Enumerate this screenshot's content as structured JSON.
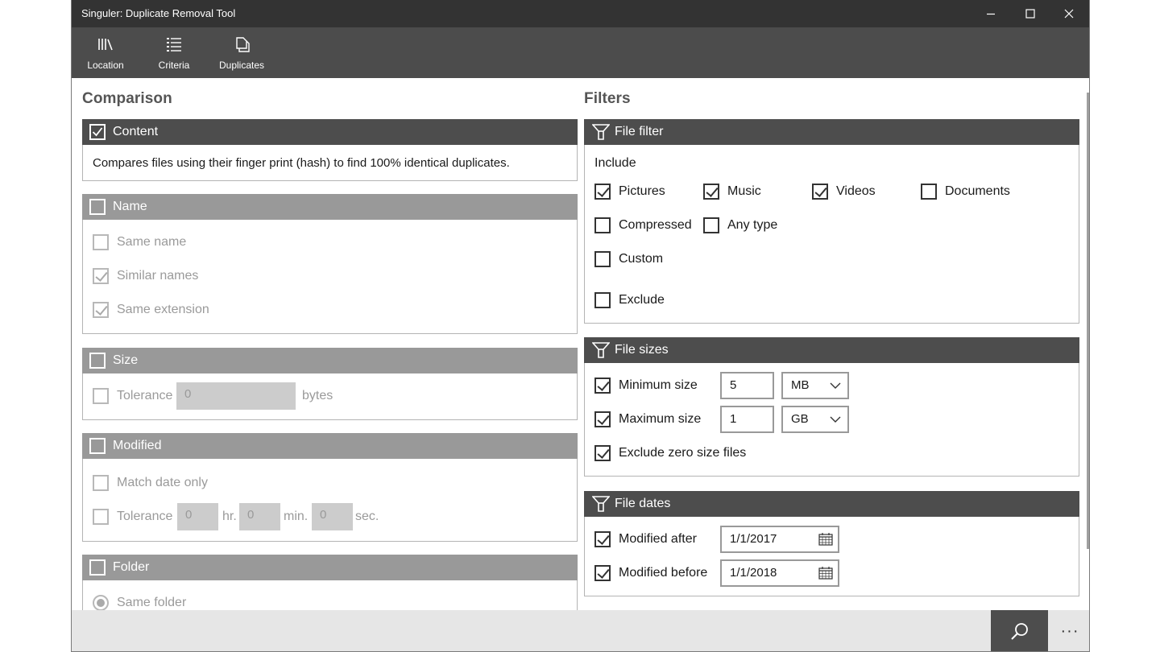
{
  "window": {
    "title": "Singuler: Duplicate Removal Tool",
    "controls": [
      "minimize-icon",
      "maximize-icon",
      "close-icon"
    ]
  },
  "nav": {
    "items": [
      {
        "label": "Location",
        "icon": "library-icon"
      },
      {
        "label": "Criteria",
        "icon": "list-icon",
        "selected": true
      },
      {
        "label": "Duplicates",
        "icon": "copy-icon"
      }
    ]
  },
  "comparison": {
    "heading": "Comparison",
    "content": {
      "label": "Content",
      "checked": true,
      "description": "Compares files using their finger print (hash) to find 100% identical duplicates."
    },
    "name": {
      "label": "Name",
      "checked": false,
      "options": [
        {
          "label": "Same name",
          "checked": false
        },
        {
          "label": "Similar names",
          "checked": true
        },
        {
          "label": "Same extension",
          "checked": true
        }
      ]
    },
    "size": {
      "label": "Size",
      "checked": false,
      "tolerance_label": "Tolerance",
      "tolerance_value": "0",
      "unit": "bytes"
    },
    "modified": {
      "label": "Modified",
      "checked": false,
      "match_date_only": "Match date only",
      "tolerance_label": "Tolerance",
      "hr_value": "0",
      "hr_unit": "hr.",
      "min_value": "0",
      "min_unit": "min.",
      "sec_value": "0",
      "sec_unit": "sec."
    },
    "folder": {
      "label": "Folder",
      "checked": false,
      "same_folder": "Same folder"
    }
  },
  "filters": {
    "heading": "Filters",
    "file_filter": {
      "label": "File filter",
      "icon": "filter-icon",
      "include_label": "Include",
      "types": [
        {
          "label": "Pictures",
          "checked": true
        },
        {
          "label": "Music",
          "checked": true
        },
        {
          "label": "Videos",
          "checked": true
        },
        {
          "label": "Documents",
          "checked": false
        },
        {
          "label": "Compressed",
          "checked": false
        },
        {
          "label": "Any type",
          "checked": false
        },
        {
          "label": "Custom",
          "checked": false
        }
      ],
      "exclude": {
        "label": "Exclude",
        "checked": false
      }
    },
    "file_sizes": {
      "label": "File sizes",
      "icon": "filter-icon",
      "min": {
        "label": "Minimum size",
        "checked": true,
        "value": "5",
        "unit": "MB"
      },
      "max": {
        "label": "Maximum size",
        "checked": true,
        "value": "1",
        "unit": "GB"
      },
      "exclude_zero": {
        "label": "Exclude zero size files",
        "checked": true
      }
    },
    "file_dates": {
      "label": "File dates",
      "icon": "filter-icon",
      "after": {
        "label": "Modified after",
        "checked": true,
        "value": "1/1/2017"
      },
      "before": {
        "label": "Modified before",
        "checked": true,
        "value": "1/1/2018"
      }
    }
  },
  "commandbar": {
    "search_icon": "search-icon",
    "more_label": "···"
  },
  "colors": {
    "titlebar": "#333333",
    "navbar": "#4c4c4c",
    "header_active": "#4d4d4d",
    "header_inactive": "#999999",
    "commandbar": "#e6e6e6"
  }
}
